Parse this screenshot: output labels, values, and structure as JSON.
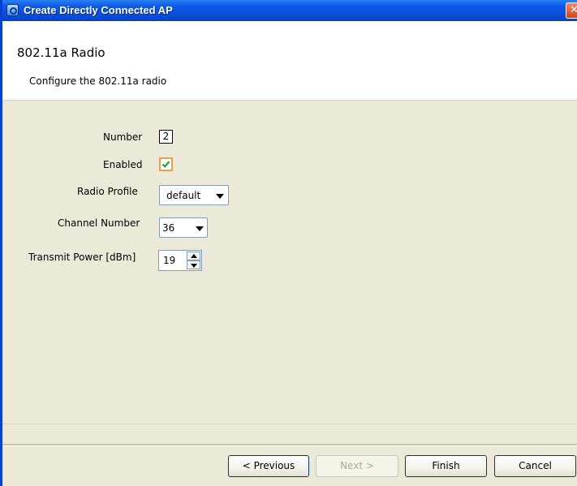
{
  "window": {
    "title": "Create Directly Connected AP"
  },
  "header": {
    "title": "802.11a Radio",
    "description": "Configure the 802.11a radio"
  },
  "form": {
    "number": {
      "label": "Number",
      "value": "2"
    },
    "enabled": {
      "label": "Enabled",
      "checked": true
    },
    "radio_profile": {
      "label": "Radio Profile",
      "value": "default"
    },
    "channel_number": {
      "label": "Channel Number",
      "value": "36"
    },
    "transmit_power": {
      "label": "Transmit Power [dBm]",
      "value": "19"
    }
  },
  "buttons": {
    "previous": "< Previous",
    "next": "Next >",
    "finish": "Finish",
    "cancel": "Cancel"
  },
  "colors": {
    "titlebar": "#0a4ed8",
    "checkbox_border": "#e8a14a",
    "checkmark": "#21a121"
  }
}
